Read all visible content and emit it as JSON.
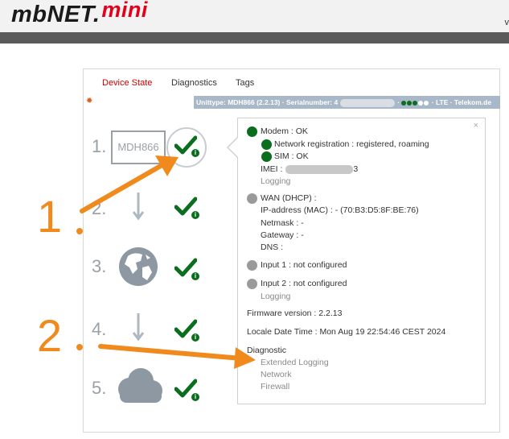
{
  "header": {
    "logo_main": "mbNET.",
    "logo_suffix": "mini",
    "corner_char": "v"
  },
  "tabs": [
    {
      "label": "Device State",
      "active": true
    },
    {
      "label": "Diagnostics",
      "active": false
    },
    {
      "label": "Tags",
      "active": false
    }
  ],
  "unit_bar": {
    "unittype": "Unittype: MDH866 (2.2.13) · Serialnumber: 4",
    "status_suffix": "· LTE · Telekom.de"
  },
  "steps": [
    {
      "num": "1.",
      "label": "MDH866",
      "icon": "device-box"
    },
    {
      "num": "2.",
      "icon": "arrow-down-icon"
    },
    {
      "num": "3.",
      "icon": "globe-icon"
    },
    {
      "num": "4.",
      "icon": "arrow-down-icon"
    },
    {
      "num": "5.",
      "icon": "cloud-icon"
    }
  ],
  "popup": {
    "close": "×",
    "modem": "Modem : OK",
    "network_registration": "Network registration : registered, roaming",
    "sim": "SIM : OK",
    "imei_label": "IMEI :",
    "imei_tail": "3",
    "logging1": "Logging",
    "wan": "WAN (DHCP) :",
    "ip_address": "IP-address (MAC) : - (70:B3:D5:8F:BE:76)",
    "netmask": "Netmask : -",
    "gateway": "Gateway : -",
    "dns": "DNS :",
    "input1": "Input 1 : not configured",
    "input2": "Input 2 : not configured",
    "logging2": "Logging",
    "firmware": "Firmware version : 2.2.13",
    "locale_time": "Locale Date Time : Mon Aug 19 22:54:46 CEST 2024",
    "diagnostic": "Diagnostic",
    "extended_logging": "Extended Logging",
    "network": "Network",
    "firewall": "Firewall"
  },
  "annotations": {
    "one": "1",
    "two": "2"
  },
  "colors": {
    "accent_red": "#cc0000",
    "status_green": "#0b6e1e",
    "annotation_orange": "#f08a1c",
    "unitbar_bg": "#a8b8c8"
  }
}
